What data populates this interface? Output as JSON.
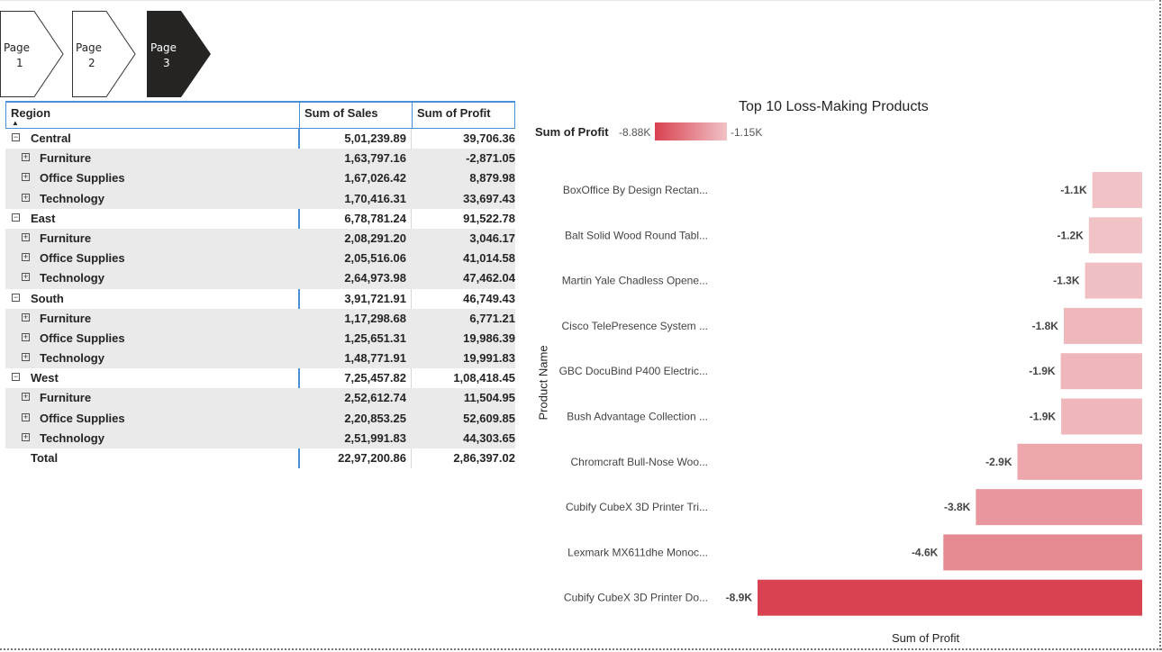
{
  "navigation": {
    "pages": [
      {
        "label": "Page",
        "num": "1",
        "active": false
      },
      {
        "label": "Page",
        "num": "2",
        "active": false
      },
      {
        "label": "Page",
        "num": "3",
        "active": true
      }
    ]
  },
  "matrix": {
    "headers": {
      "region": "Region",
      "sales": "Sum of Sales",
      "profit": "Sum of Profit"
    },
    "rows": [
      {
        "level": "region",
        "expander": "⊟",
        "name": "Central",
        "sales": "5,01,239.89",
        "profit": "39,706.36"
      },
      {
        "level": "sub",
        "expander": "⊞",
        "name": "Furniture",
        "sales": "1,63,797.16",
        "profit": "-2,871.05"
      },
      {
        "level": "sub",
        "expander": "⊞",
        "name": "Office Supplies",
        "sales": "1,67,026.42",
        "profit": "8,879.98"
      },
      {
        "level": "sub",
        "expander": "⊞",
        "name": "Technology",
        "sales": "1,70,416.31",
        "profit": "33,697.43"
      },
      {
        "level": "region",
        "expander": "⊟",
        "name": "East",
        "sales": "6,78,781.24",
        "profit": "91,522.78"
      },
      {
        "level": "sub",
        "expander": "⊞",
        "name": "Furniture",
        "sales": "2,08,291.20",
        "profit": "3,046.17"
      },
      {
        "level": "sub",
        "expander": "⊞",
        "name": "Office Supplies",
        "sales": "2,05,516.06",
        "profit": "41,014.58"
      },
      {
        "level": "sub",
        "expander": "⊞",
        "name": "Technology",
        "sales": "2,64,973.98",
        "profit": "47,462.04"
      },
      {
        "level": "region",
        "expander": "⊟",
        "name": "South",
        "sales": "3,91,721.91",
        "profit": "46,749.43"
      },
      {
        "level": "sub",
        "expander": "⊞",
        "name": "Furniture",
        "sales": "1,17,298.68",
        "profit": "6,771.21"
      },
      {
        "level": "sub",
        "expander": "⊞",
        "name": "Office Supplies",
        "sales": "1,25,651.31",
        "profit": "19,986.39"
      },
      {
        "level": "sub",
        "expander": "⊞",
        "name": "Technology",
        "sales": "1,48,771.91",
        "profit": "19,991.83"
      },
      {
        "level": "region",
        "expander": "⊟",
        "name": "West",
        "sales": "7,25,457.82",
        "profit": "1,08,418.45"
      },
      {
        "level": "sub",
        "expander": "⊞",
        "name": "Furniture",
        "sales": "2,52,612.74",
        "profit": "11,504.95"
      },
      {
        "level": "sub",
        "expander": "⊞",
        "name": "Office Supplies",
        "sales": "2,20,853.25",
        "profit": "52,609.85"
      },
      {
        "level": "sub",
        "expander": "⊞",
        "name": "Technology",
        "sales": "2,51,991.83",
        "profit": "44,303.65"
      }
    ],
    "total": {
      "name": "Total",
      "sales": "22,97,200.86",
      "profit": "2,86,397.02"
    }
  },
  "chart_data": {
    "type": "bar",
    "orientation": "horizontal",
    "title": "Top 10 Loss-Making Products",
    "xlabel": "Sum of Profit",
    "ylabel": "Product Name",
    "legend": {
      "title": "Sum of Profit",
      "min_label": "-8.88K",
      "max_label": "-1.15K",
      "color_min": "#d94250",
      "color_max": "#f1c3c7"
    },
    "categories": [
      "BoxOffice By Design Rectan...",
      "Balt Solid Wood Round Tabl...",
      "Martin Yale Chadless Opene...",
      "Cisco TelePresence System ...",
      "GBC DocuBind P400 Electric...",
      "Bush Advantage Collection ...",
      "Chromcraft Bull-Nose Woo...",
      "Cubify CubeX 3D Printer Tri...",
      "Lexmark MX611dhe Monoc...",
      "Cubify CubeX 3D Printer Do..."
    ],
    "values": [
      -1150,
      -1230,
      -1320,
      -1810,
      -1880,
      -1870,
      -2880,
      -3840,
      -4590,
      -8880
    ],
    "data_labels": [
      "-1.1K",
      "-1.2K",
      "-1.3K",
      "-1.8K",
      "-1.9K",
      "-1.9K",
      "-2.9K",
      "-3.8K",
      "-4.6K",
      "-8.9K"
    ],
    "xlim": [
      -8880,
      0
    ]
  }
}
